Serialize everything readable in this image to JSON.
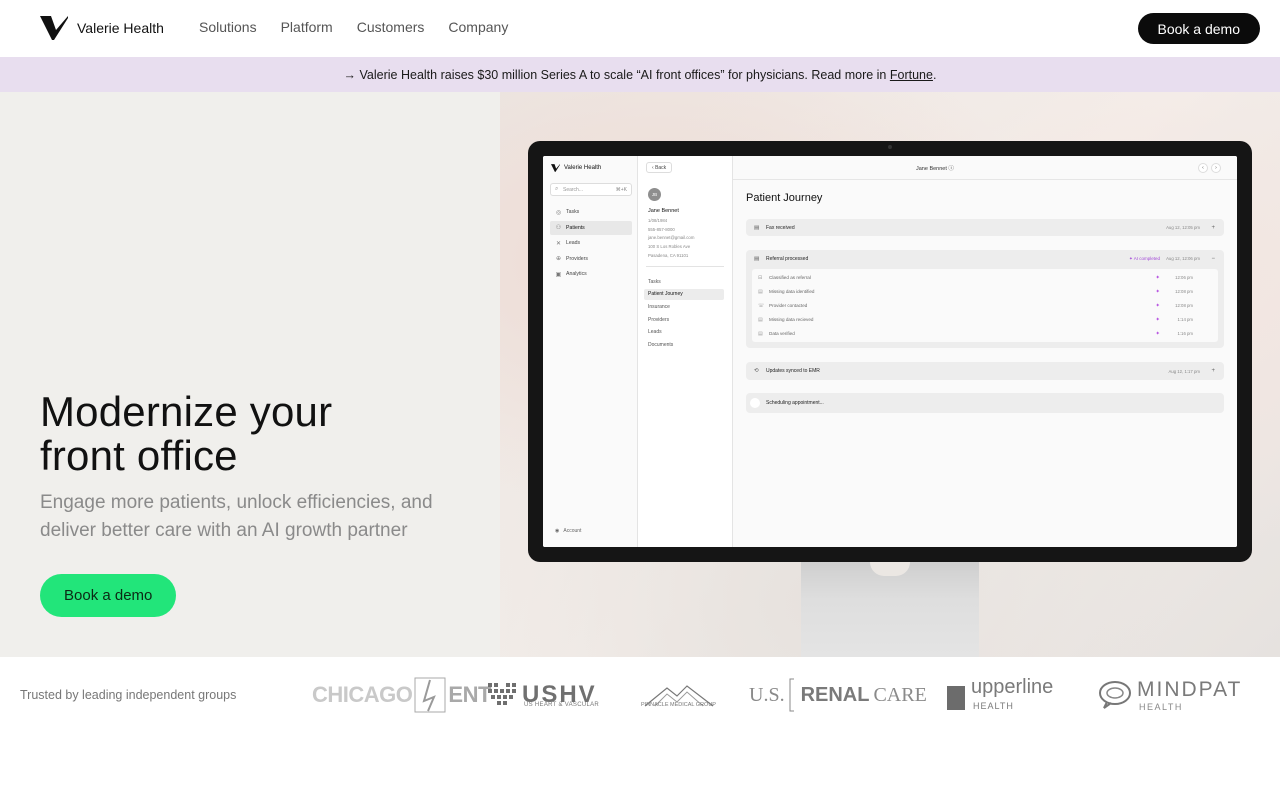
{
  "nav": {
    "brand": "Valerie Health",
    "items": [
      "Solutions",
      "Platform",
      "Customers",
      "Company"
    ],
    "cta": "Book a demo"
  },
  "banner": {
    "text": "→ Valerie Health raises $30 million Series A to scale “AI front offices” for physicians. Read more in ",
    "link": "Fortune",
    "suffix": "."
  },
  "hero": {
    "title_line1": "Modernize your",
    "title_line2": "front office",
    "subtitle": "Engage more patients, unlock efficiencies, and deliver better care with an AI growth partner",
    "cta": "Book a demo"
  },
  "app": {
    "brand": "Valerie Health",
    "search_placeholder": "Search...",
    "search_shortcut": "⌘+K",
    "sidebar": [
      "Tasks",
      "Patients",
      "Leads",
      "Providers",
      "Analytics"
    ],
    "account": "Account",
    "back": "Back",
    "patient": {
      "initials": "JB",
      "name": "Jane Bennet",
      "dob": "1/08/1984",
      "phone": "555-857-8000",
      "email": "jane.bennet@gmail.com",
      "address1": "100 S Los Robles Ave",
      "address2": "Pasadena, CA 91101"
    },
    "patient_nav": [
      "Tasks",
      "Patient Journey",
      "Insurance",
      "Providers",
      "Leads",
      "Documents"
    ],
    "top_name": "Jane Bennet",
    "journey_title": "Patient Journey",
    "events": {
      "fax": {
        "label": "Fax received",
        "time": "Aug 12, 12:05 pm"
      },
      "referral": {
        "label": "Referral processed",
        "badge": "AI completed",
        "time": "Aug 12, 12:06 pm"
      },
      "steps": [
        {
          "label": "Classified as referral",
          "time": "12:06 pm"
        },
        {
          "label": "Missing data identified",
          "time": "12:08 pm"
        },
        {
          "label": "Provider contacted",
          "time": "12:08 pm"
        },
        {
          "label": "Missing data recieved",
          "time": "1:14 pm"
        },
        {
          "label": "Data verified",
          "time": "1:16 pm"
        }
      ],
      "emr": {
        "label": "Updates synced to EMR",
        "time": "Aug 12, 1:17 pm"
      },
      "scheduling": {
        "label": "Scheduling appointment..."
      }
    }
  },
  "trusted": {
    "label": "Trusted by leading independent groups",
    "logos": {
      "chicago_a": "CHICAGO",
      "chicago_b": "ENT",
      "ushv_big": "USHV",
      "ushv_small": "US HEART & VASCULAR",
      "pinnacle": "PINNACLE MEDICAL GROUP",
      "renal_us": "U.S.",
      "renal_mid": "RENAL",
      "renal_care": "CARE",
      "upper_big": "upperline",
      "upper_small": "HEALTH",
      "mind_big": "MINDPATH",
      "mind_small": "HEALTH"
    }
  }
}
